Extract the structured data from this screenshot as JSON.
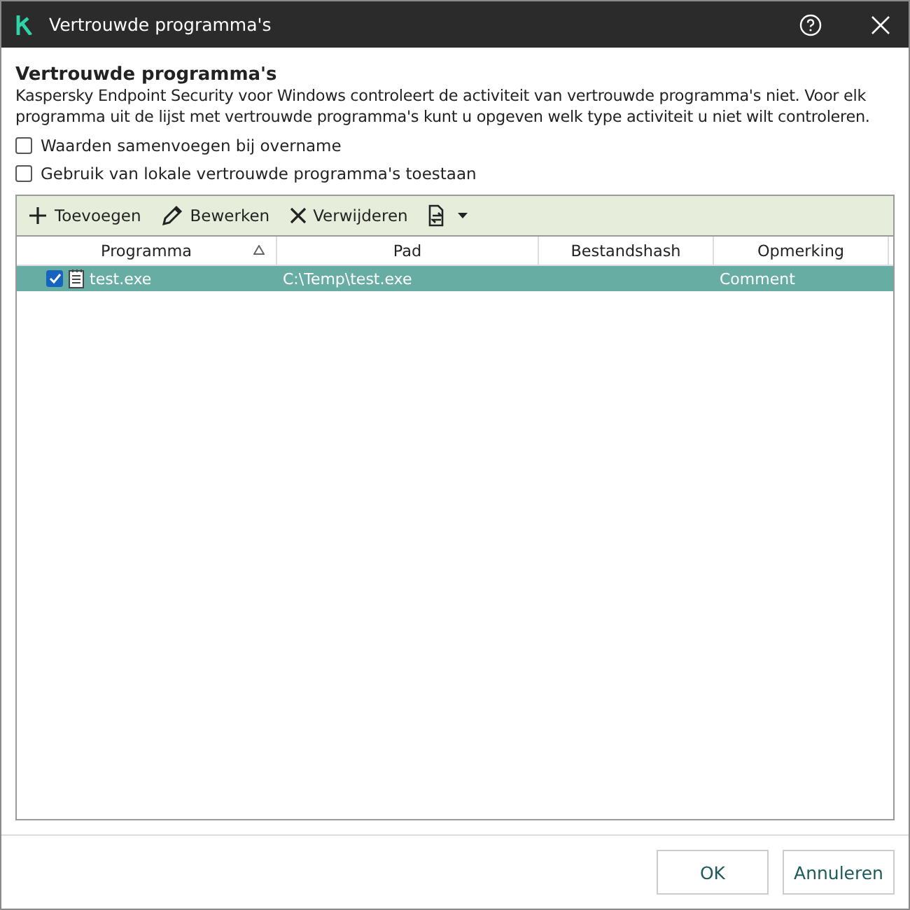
{
  "window": {
    "title": "Vertrouwde programma's"
  },
  "heading": "Vertrouwde programma's",
  "description": "Kaspersky Endpoint Security voor Windows controleert de activiteit van vertrouwde programma's niet. Voor elk programma uit de lijst met vertrouwde programma's kunt u opgeven welk type activiteit u niet wilt controleren.",
  "options": [
    {
      "label": "Waarden samenvoegen bij overname",
      "checked": false
    },
    {
      "label": "Gebruik van lokale vertrouwde programma's toestaan",
      "checked": false
    }
  ],
  "toolbar": [
    {
      "kind": "add",
      "label": "Toevoegen"
    },
    {
      "kind": "edit",
      "label": "Bewerken"
    },
    {
      "kind": "delete",
      "label": "Verwijderen"
    },
    {
      "kind": "import-export"
    }
  ],
  "table": {
    "columns": [
      {
        "label": "Programma",
        "sorted": true
      },
      {
        "label": "Pad",
        "sorted": false
      },
      {
        "label": "Bestandshash",
        "sorted": false
      },
      {
        "label": "Opmerking",
        "sorted": false
      }
    ],
    "rows": [
      {
        "selected": true,
        "checked": true,
        "cells": [
          "test.exe",
          "C:\\Temp\\test.exe",
          "",
          "Comment"
        ]
      }
    ]
  },
  "buttons": [
    "OK",
    "Annuleren"
  ]
}
